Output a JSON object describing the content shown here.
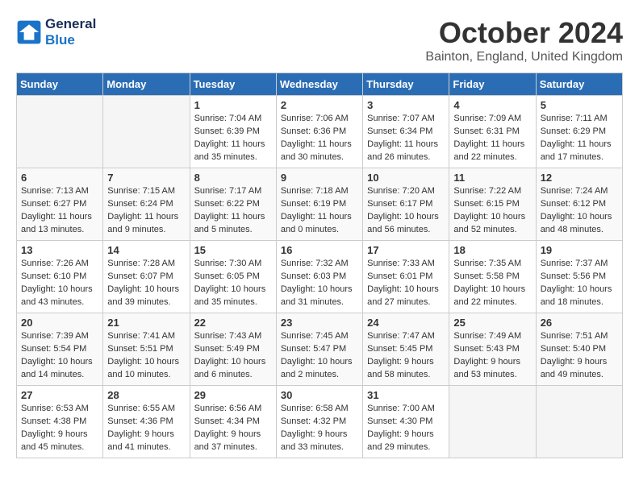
{
  "header": {
    "logo_line1": "General",
    "logo_line2": "Blue",
    "month": "October 2024",
    "location": "Bainton, England, United Kingdom"
  },
  "weekdays": [
    "Sunday",
    "Monday",
    "Tuesday",
    "Wednesday",
    "Thursday",
    "Friday",
    "Saturday"
  ],
  "weeks": [
    [
      {
        "day": "",
        "empty": true
      },
      {
        "day": "",
        "empty": true
      },
      {
        "day": "1",
        "sunrise": "Sunrise: 7:04 AM",
        "sunset": "Sunset: 6:39 PM",
        "daylight": "Daylight: 11 hours and 35 minutes."
      },
      {
        "day": "2",
        "sunrise": "Sunrise: 7:06 AM",
        "sunset": "Sunset: 6:36 PM",
        "daylight": "Daylight: 11 hours and 30 minutes."
      },
      {
        "day": "3",
        "sunrise": "Sunrise: 7:07 AM",
        "sunset": "Sunset: 6:34 PM",
        "daylight": "Daylight: 11 hours and 26 minutes."
      },
      {
        "day": "4",
        "sunrise": "Sunrise: 7:09 AM",
        "sunset": "Sunset: 6:31 PM",
        "daylight": "Daylight: 11 hours and 22 minutes."
      },
      {
        "day": "5",
        "sunrise": "Sunrise: 7:11 AM",
        "sunset": "Sunset: 6:29 PM",
        "daylight": "Daylight: 11 hours and 17 minutes."
      }
    ],
    [
      {
        "day": "6",
        "sunrise": "Sunrise: 7:13 AM",
        "sunset": "Sunset: 6:27 PM",
        "daylight": "Daylight: 11 hours and 13 minutes."
      },
      {
        "day": "7",
        "sunrise": "Sunrise: 7:15 AM",
        "sunset": "Sunset: 6:24 PM",
        "daylight": "Daylight: 11 hours and 9 minutes."
      },
      {
        "day": "8",
        "sunrise": "Sunrise: 7:17 AM",
        "sunset": "Sunset: 6:22 PM",
        "daylight": "Daylight: 11 hours and 5 minutes."
      },
      {
        "day": "9",
        "sunrise": "Sunrise: 7:18 AM",
        "sunset": "Sunset: 6:19 PM",
        "daylight": "Daylight: 11 hours and 0 minutes."
      },
      {
        "day": "10",
        "sunrise": "Sunrise: 7:20 AM",
        "sunset": "Sunset: 6:17 PM",
        "daylight": "Daylight: 10 hours and 56 minutes."
      },
      {
        "day": "11",
        "sunrise": "Sunrise: 7:22 AM",
        "sunset": "Sunset: 6:15 PM",
        "daylight": "Daylight: 10 hours and 52 minutes."
      },
      {
        "day": "12",
        "sunrise": "Sunrise: 7:24 AM",
        "sunset": "Sunset: 6:12 PM",
        "daylight": "Daylight: 10 hours and 48 minutes."
      }
    ],
    [
      {
        "day": "13",
        "sunrise": "Sunrise: 7:26 AM",
        "sunset": "Sunset: 6:10 PM",
        "daylight": "Daylight: 10 hours and 43 minutes."
      },
      {
        "day": "14",
        "sunrise": "Sunrise: 7:28 AM",
        "sunset": "Sunset: 6:07 PM",
        "daylight": "Daylight: 10 hours and 39 minutes."
      },
      {
        "day": "15",
        "sunrise": "Sunrise: 7:30 AM",
        "sunset": "Sunset: 6:05 PM",
        "daylight": "Daylight: 10 hours and 35 minutes."
      },
      {
        "day": "16",
        "sunrise": "Sunrise: 7:32 AM",
        "sunset": "Sunset: 6:03 PM",
        "daylight": "Daylight: 10 hours and 31 minutes."
      },
      {
        "day": "17",
        "sunrise": "Sunrise: 7:33 AM",
        "sunset": "Sunset: 6:01 PM",
        "daylight": "Daylight: 10 hours and 27 minutes."
      },
      {
        "day": "18",
        "sunrise": "Sunrise: 7:35 AM",
        "sunset": "Sunset: 5:58 PM",
        "daylight": "Daylight: 10 hours and 22 minutes."
      },
      {
        "day": "19",
        "sunrise": "Sunrise: 7:37 AM",
        "sunset": "Sunset: 5:56 PM",
        "daylight": "Daylight: 10 hours and 18 minutes."
      }
    ],
    [
      {
        "day": "20",
        "sunrise": "Sunrise: 7:39 AM",
        "sunset": "Sunset: 5:54 PM",
        "daylight": "Daylight: 10 hours and 14 minutes."
      },
      {
        "day": "21",
        "sunrise": "Sunrise: 7:41 AM",
        "sunset": "Sunset: 5:51 PM",
        "daylight": "Daylight: 10 hours and 10 minutes."
      },
      {
        "day": "22",
        "sunrise": "Sunrise: 7:43 AM",
        "sunset": "Sunset: 5:49 PM",
        "daylight": "Daylight: 10 hours and 6 minutes."
      },
      {
        "day": "23",
        "sunrise": "Sunrise: 7:45 AM",
        "sunset": "Sunset: 5:47 PM",
        "daylight": "Daylight: 10 hours and 2 minutes."
      },
      {
        "day": "24",
        "sunrise": "Sunrise: 7:47 AM",
        "sunset": "Sunset: 5:45 PM",
        "daylight": "Daylight: 9 hours and 58 minutes."
      },
      {
        "day": "25",
        "sunrise": "Sunrise: 7:49 AM",
        "sunset": "Sunset: 5:43 PM",
        "daylight": "Daylight: 9 hours and 53 minutes."
      },
      {
        "day": "26",
        "sunrise": "Sunrise: 7:51 AM",
        "sunset": "Sunset: 5:40 PM",
        "daylight": "Daylight: 9 hours and 49 minutes."
      }
    ],
    [
      {
        "day": "27",
        "sunrise": "Sunrise: 6:53 AM",
        "sunset": "Sunset: 4:38 PM",
        "daylight": "Daylight: 9 hours and 45 minutes."
      },
      {
        "day": "28",
        "sunrise": "Sunrise: 6:55 AM",
        "sunset": "Sunset: 4:36 PM",
        "daylight": "Daylight: 9 hours and 41 minutes."
      },
      {
        "day": "29",
        "sunrise": "Sunrise: 6:56 AM",
        "sunset": "Sunset: 4:34 PM",
        "daylight": "Daylight: 9 hours and 37 minutes."
      },
      {
        "day": "30",
        "sunrise": "Sunrise: 6:58 AM",
        "sunset": "Sunset: 4:32 PM",
        "daylight": "Daylight: 9 hours and 33 minutes."
      },
      {
        "day": "31",
        "sunrise": "Sunrise: 7:00 AM",
        "sunset": "Sunset: 4:30 PM",
        "daylight": "Daylight: 9 hours and 29 minutes."
      },
      {
        "day": "",
        "empty": true
      },
      {
        "day": "",
        "empty": true
      }
    ]
  ]
}
